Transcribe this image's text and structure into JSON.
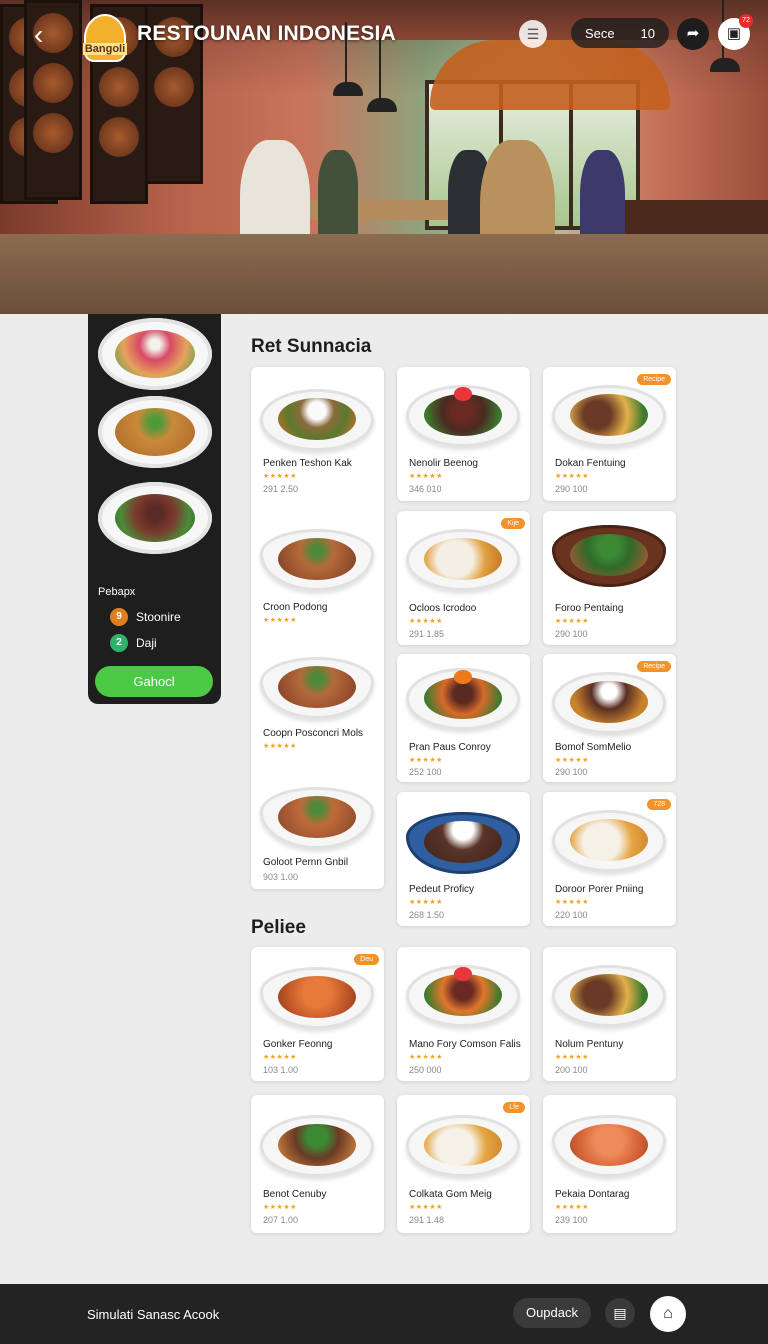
{
  "header": {
    "back_icon": "chevron-left-icon",
    "logo_text": "Bangoli",
    "title": "RESTOUNAN INDONESIA",
    "filter_icon": "filter-icon",
    "search_label": "Sece",
    "search_count": "10",
    "share_icon": "share-icon",
    "cart_icon": "cart-icon",
    "cart_badge": "72"
  },
  "sidebar": {
    "section_label": "Pebapx",
    "options": [
      {
        "label": "Stoonire",
        "icon": "orange-circle-icon",
        "glyph": "9",
        "color": "#e07f1f"
      },
      {
        "label": "Daji",
        "icon": "green-circle-icon",
        "glyph": "2",
        "color": "#2fb36b"
      }
    ],
    "cta_label": "Gahocl"
  },
  "sections": [
    {
      "title": "Ret Sunnacia"
    },
    {
      "title": "Peliee"
    }
  ],
  "cards": [
    {
      "name": "Penken Teshon Kak",
      "stars": "★★★★★",
      "price": "291 2.50"
    },
    {
      "name": "Nenolir Beenog",
      "stars": "★★★★★",
      "price": "346 010"
    },
    {
      "name": "Dokan Fentuing",
      "stars": "★★★★★",
      "price": "290 100",
      "badge": "Recipe"
    },
    {
      "name": "Croon Podong",
      "stars": "★★★★★",
      "price": ""
    },
    {
      "name": "Ocloos Icrodoo",
      "stars": "★★★★★",
      "price": "291 1.85",
      "badge": "Kije"
    },
    {
      "name": "Foroo Pentaing",
      "stars": "★★★★★",
      "price": "290 100"
    },
    {
      "name": "Coopn Posconcri Mols",
      "stars": "★★★★★",
      "price": ""
    },
    {
      "name": "Pran Paus Conroy",
      "stars": "★★★★★",
      "price": "252 100"
    },
    {
      "name": "Bomof SomMelio",
      "stars": "★★★★★",
      "price": "290 100",
      "badge": "Recipe"
    },
    {
      "name": "Goloot Pernn Gnbil",
      "stars": "",
      "price": "903 1.00"
    },
    {
      "name": "Pedeut Proficy",
      "stars": "★★★★★",
      "price": "268 1.50"
    },
    {
      "name": "Doroor Porer Pniing",
      "stars": "★★★★★",
      "price": "220 100",
      "badge": "728"
    },
    {
      "name": "Gonker Feonng",
      "stars": "★★★★★",
      "price": "103 1.00",
      "badge": "Deu"
    },
    {
      "name": "Mano Fory Comson Falis",
      "stars": "★★★★★",
      "price": "250 000"
    },
    {
      "name": "Nolum Pentuny",
      "stars": "★★★★★",
      "price": "200 100"
    },
    {
      "name": "Benot Cenuby",
      "stars": "★★★★★",
      "price": "207 1.00"
    },
    {
      "name": "Colkata Gom Meig",
      "stars": "★★★★★",
      "price": "291 1.48",
      "badge": "Lfe"
    },
    {
      "name": "Pekaia Dontarag",
      "stars": "★★★★★",
      "price": "239 100"
    }
  ],
  "bottom": {
    "text": "Simulati Sanasc Acook",
    "pill_label": "Oupdack",
    "icon": "chat-icon",
    "home_icon": "home-icon"
  },
  "colors": {
    "accent_green": "#4cca45",
    "badge_orange": "#f0932b",
    "star": "#f0a322",
    "sidebar_bg": "#1e1e1f"
  }
}
